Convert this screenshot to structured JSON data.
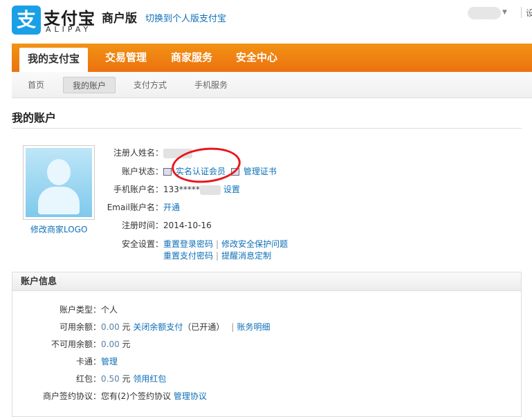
{
  "header": {
    "logo_char": "支",
    "logo_cn": "支付宝",
    "logo_en": "ALIPAY",
    "edition": "商户版",
    "switch_link": "切换到个人版支付宝",
    "right_cut": "设"
  },
  "nav": {
    "tabs": [
      "我的支付宝",
      "交易管理",
      "商家服务",
      "安全中心"
    ],
    "sub": [
      "首页",
      "我的账户",
      "支付方式",
      "手机服务"
    ]
  },
  "page_title": "我的账户",
  "profile": {
    "logo_link": "修改商家LOGO",
    "name_label": "注册人姓名：",
    "status_label": "账户状态：",
    "status_value": "实名认证会员",
    "manage_cert": "管理证书",
    "phone_label": "手机账户名：",
    "phone_value": "133*****",
    "phone_set": "设置",
    "email_label": "Email账户名：",
    "email_open": "开通",
    "reg_label": "注册时间：",
    "reg_value": "2014-10-16",
    "sec_label": "安全设置：",
    "sec_links": [
      "重置登录密码",
      "修改安全保护问题",
      "重置支付密码",
      "提醒消息定制"
    ]
  },
  "account_info": {
    "title": "账户信息",
    "type_label": "账户类型：",
    "type_value": "个人",
    "avail_label": "可用余额：",
    "avail_value": "0.00",
    "unit": "元",
    "close_balance": "关闭余额支付",
    "opened": "（已开通）",
    "detail": "账务明细",
    "unavail_label": "不可用余额：",
    "unavail_value": "0.00",
    "card_label": "卡通：",
    "card_manage": "管理",
    "hongbao_label": "红包：",
    "hongbao_value": "0.50",
    "hongbao_link": "领用红包",
    "agree_label": "商户签约协议：",
    "agree_value": "您有(2)个签约协议",
    "agree_link": "管理协议"
  }
}
